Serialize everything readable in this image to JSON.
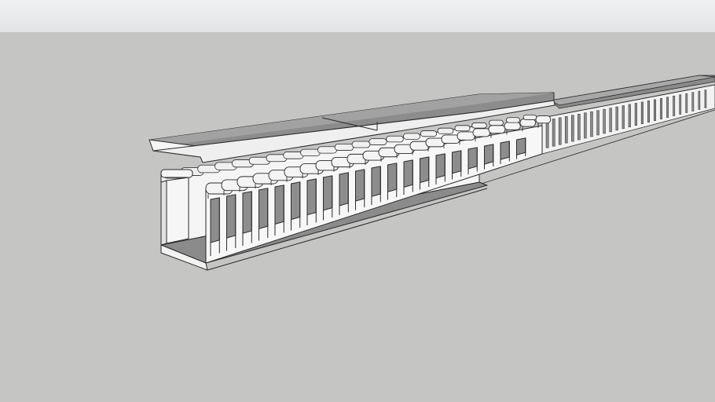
{
  "scene": {
    "sky_color": "#e9ebed",
    "ground_color": "#c5c5c4",
    "model": {
      "name": "slotted-wire-duct",
      "style": "hidden-line",
      "line_color": "#2a2a2a",
      "face_color": "#f4f4f4",
      "shadow_color": "#8a8a8a"
    }
  }
}
